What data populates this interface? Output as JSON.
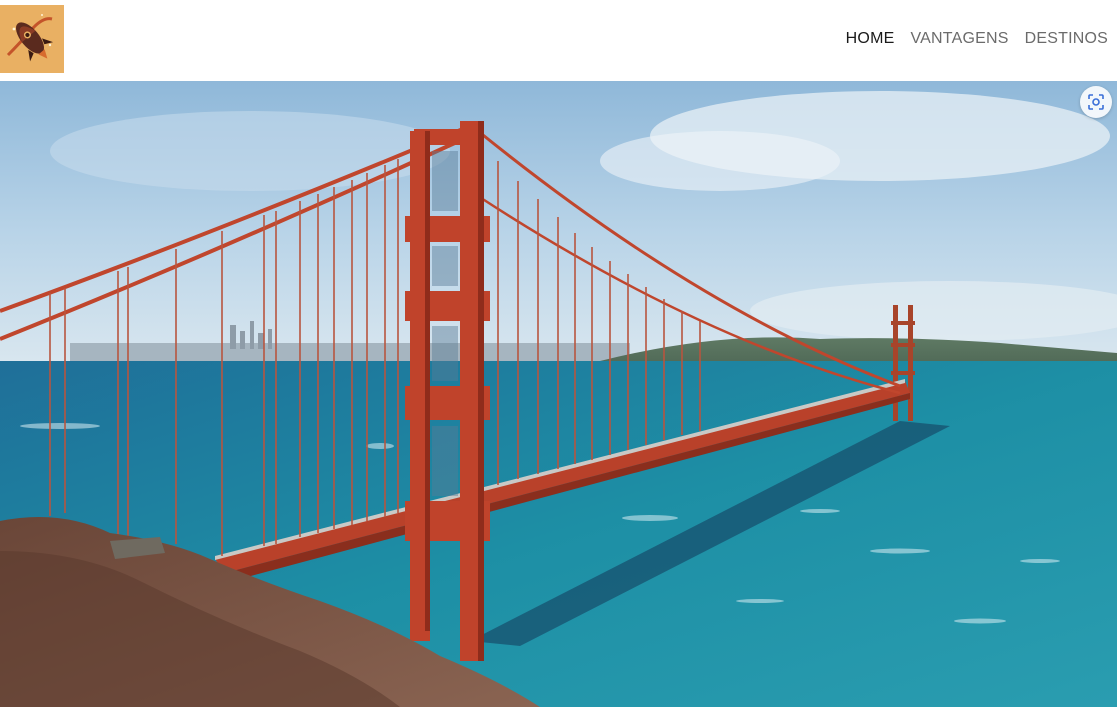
{
  "header": {
    "logo_icon": "rocket-icon",
    "logo_background": "#e9b063"
  },
  "nav": {
    "items": [
      {
        "label": "HOME",
        "active": true
      },
      {
        "label": "VANTAGENS",
        "active": false
      },
      {
        "label": "DESTINOS",
        "active": false
      }
    ],
    "active_color": "#1a1a1a",
    "inactive_color": "#6b6b6b"
  },
  "hero": {
    "image": "golden-gate-bridge-photo",
    "overlay_button_icon": "visual-search-icon"
  }
}
